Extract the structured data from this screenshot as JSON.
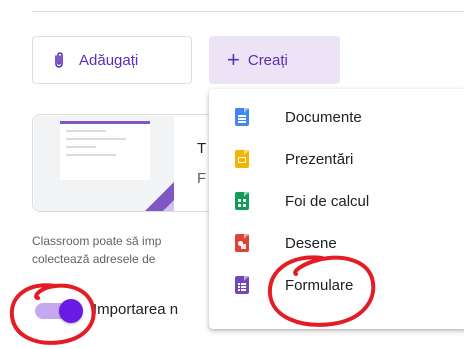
{
  "toolbar": {
    "add_label": "Adăugați",
    "create_label": "Creați",
    "add_icon": "paperclip-icon",
    "create_icon": "plus-icon"
  },
  "card": {
    "title": "T",
    "subtitle": "F"
  },
  "info": {
    "line1": "Classroom poate să imp",
    "line2": "colectează adresele de"
  },
  "toggle": {
    "state": true,
    "label": "Importarea n"
  },
  "create_menu": {
    "items": [
      {
        "label": "Documente",
        "icon": "google-docs-icon",
        "color": "#4285f4"
      },
      {
        "label": "Prezentări",
        "icon": "google-slides-icon",
        "color": "#f4b400"
      },
      {
        "label": "Foi de calcul",
        "icon": "google-sheets-icon",
        "color": "#0f9d58"
      },
      {
        "label": "Desene",
        "icon": "google-drawings-icon",
        "color": "#db4437"
      },
      {
        "label": "Formulare",
        "icon": "google-forms-icon",
        "color": "#7248b9"
      }
    ]
  },
  "colors": {
    "accent": "#5b2db8",
    "create_bg": "#ede3f7",
    "annotation": "#e51c23"
  }
}
